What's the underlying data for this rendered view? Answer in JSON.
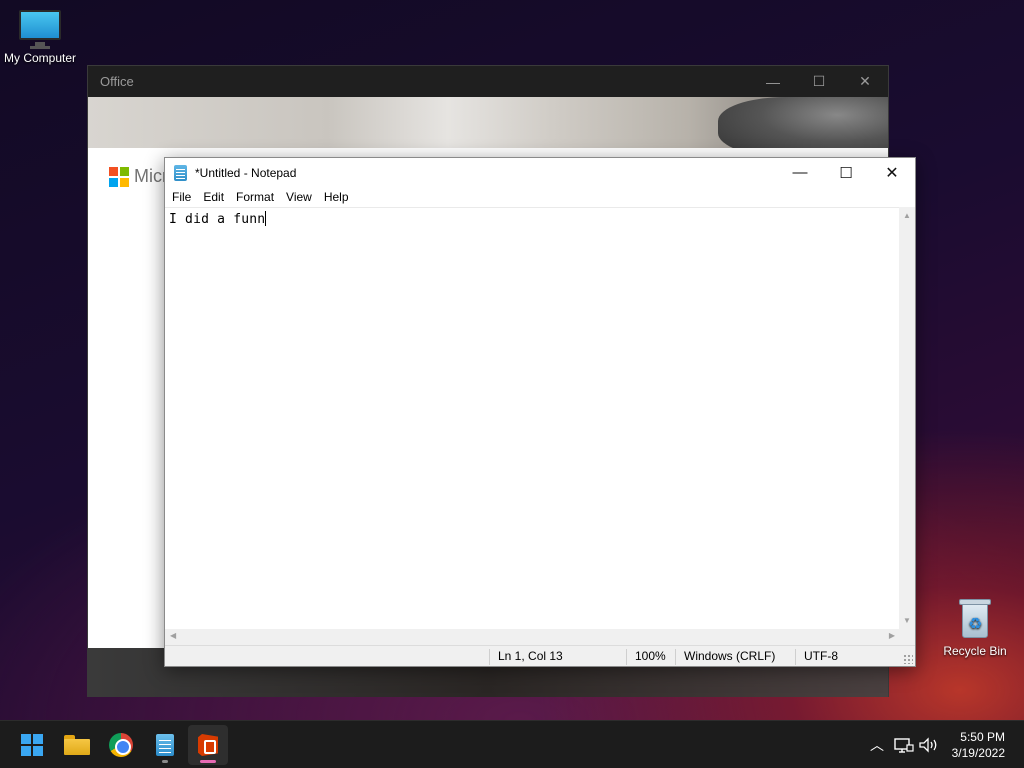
{
  "desktop": {
    "my_computer_label": "My Computer",
    "recycle_bin_label": "Recycle Bin"
  },
  "office_window": {
    "title": "Office",
    "brand_partial": "Micr",
    "controls": {
      "minimize": "—",
      "maximize": "☐",
      "close": "✕"
    }
  },
  "notepad": {
    "title": "*Untitled - Notepad",
    "controls": {
      "minimize": "—",
      "maximize": "☐",
      "close": "✕"
    },
    "menu": [
      "File",
      "Edit",
      "Format",
      "View",
      "Help"
    ],
    "content": "I did a funn",
    "status": {
      "position": "Ln 1, Col 13",
      "zoom": "100%",
      "line_ending": "Windows (CRLF)",
      "encoding": "UTF-8"
    }
  },
  "taskbar": {
    "apps": [
      {
        "name": "start-icon"
      },
      {
        "name": "file-explorer-icon"
      },
      {
        "name": "chrome-icon"
      },
      {
        "name": "notepad-icon"
      },
      {
        "name": "office-icon"
      }
    ],
    "tray_icons": [
      "chevron-up-icon",
      "network-icon",
      "volume-icon"
    ],
    "time": "5:50 PM",
    "date": "3/19/2022"
  },
  "colors": {
    "accent_windows": "#3aa7f2",
    "active_indicator": "#e76ab3",
    "office_red": "#d83b01"
  }
}
